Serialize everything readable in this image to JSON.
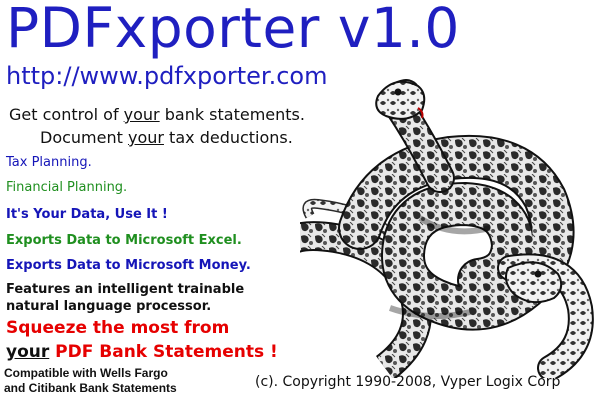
{
  "header": {
    "title": "PDFxporter v1.0",
    "url": "http://www.pdfxporter.com"
  },
  "tagline": {
    "line1_pre": "Get control of ",
    "line1_under": "your",
    "line1_post": " bank statements.",
    "line2_pre": "Document ",
    "line2_under": "your",
    "line2_post": " tax deductions."
  },
  "features": [
    "Tax Planning.",
    "Financial Planning.",
    "It's Your Data, Use It !",
    "Exports Data to Microsoft Excel.",
    "Exports Data to Microsoft Money."
  ],
  "nlp": {
    "line1": "Features an intelligent trainable",
    "line2": "natural language processor."
  },
  "squeeze": {
    "line1": "Squeeze the most from",
    "line2_under": "your",
    "line2_post": " PDF Bank Statements !"
  },
  "compat": {
    "line1": "Compatible with Wells Fargo",
    "line2": "and Citibank Bank Statements"
  },
  "copyright": "(c). Copyright 1990-2008, Vyper Logix Corp",
  "colors": {
    "title_blue": "#1f1fc0",
    "feature_blue": "#1515b8",
    "feature_green": "#1f8f1f",
    "accent_red": "#e60000"
  },
  "illustration": "python-snake-illustration"
}
